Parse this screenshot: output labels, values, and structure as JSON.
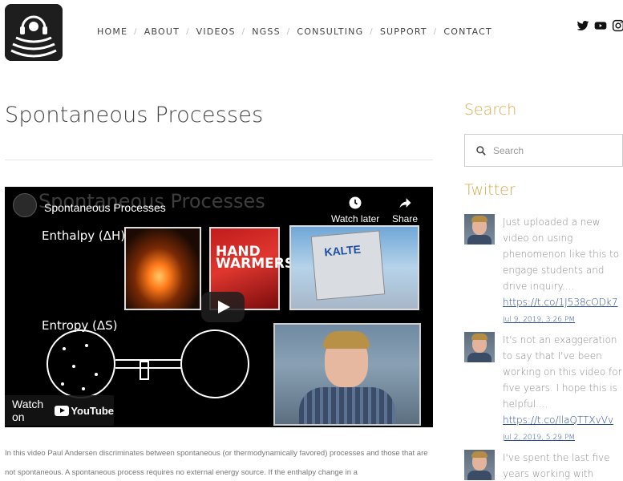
{
  "header": {
    "logo_alt": "Bozeman Science logo",
    "nav": [
      "HOME",
      "ABOUT",
      "VIDEOS",
      "NGSS",
      "CONSULTING",
      "SUPPORT",
      "CONTACT"
    ],
    "social_icons": [
      "twitter-icon",
      "youtube-icon",
      "instagram-icon"
    ]
  },
  "main": {
    "title": "Spontaneous Processes",
    "video": {
      "slide_title": "Spontaneous Processes",
      "title": "Spontaneous Processes",
      "watch_later": "Watch later",
      "share": "Share",
      "enthalpy_label": "Enthalpy (ΔH)",
      "entropy_label": "Entropy (ΔS)",
      "hand_warmers_text": "HAND WARMERS",
      "kalte_text": "KALTE",
      "watch_on": "Watch on",
      "youtube": "YouTube"
    },
    "description": "In this video Paul Andersen discriminates between spontaneous (or thermodynamically favored) processes and those that are not spontaneous. A spontaneous process requires no external energy source. If the enthalpy change in a"
  },
  "sidebar": {
    "search_heading": "Search",
    "search_placeholder": "Search",
    "twitter_heading": "Twitter",
    "tweets": [
      {
        "text": "Just uploaded a new video on using phenomenon like this to engage students and drive inquiry....",
        "link": "https://t.co/1J538cODk7",
        "time": "Jul 9, 2019, 3:26 PM"
      },
      {
        "text": "It's not an exaggeration to say that I've been working on this video for five years. I hope this is helpful....",
        "link": "https://t.co/llaQTTXvVv",
        "time": "Jul 2, 2019, 5:29 PM"
      },
      {
        "text": "I've spent the last five years working with"
      }
    ]
  },
  "colors": {
    "accent": "#d9a94e",
    "link": "#2a4d8f"
  }
}
